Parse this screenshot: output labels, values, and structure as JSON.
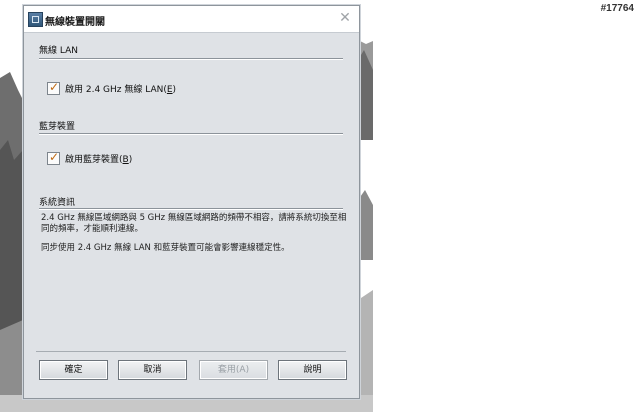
{
  "watermark": "#17764",
  "dialog": {
    "title": "無線裝置開關",
    "close_glyph": "✕"
  },
  "wireless_lan": {
    "section_label": "無線 LAN",
    "checkbox_label": "啟用 2.4 GHz 無線 LAN",
    "mnemonic": "E",
    "checked": true
  },
  "bluetooth": {
    "section_label": "藍芽裝置",
    "checkbox_label": "啟用藍芽裝置",
    "mnemonic": "B",
    "checked": true
  },
  "system_info": {
    "section_label": "系統資訊",
    "paragraph_1": "2.4 GHz 無線區域網路與 5 GHz 無線區域網路的頻帶不相容，請將系統切換至相同的頻率，才能順利連線。",
    "paragraph_2": "同步使用 2.4 GHz 無線 LAN 和藍芽裝置可能會影響連線穩定性。"
  },
  "buttons": {
    "ok": "確定",
    "cancel": "取消",
    "apply": "套用(A)",
    "help": "說明"
  },
  "icons": {
    "app": "wireless-switch-app-icon",
    "close": "close-icon",
    "check": "checkmark-icon"
  },
  "colors": {
    "dialog_bg": "#dfe2e6",
    "check_mark": "#c06a12",
    "disabled_text": "#9aa0a6"
  }
}
